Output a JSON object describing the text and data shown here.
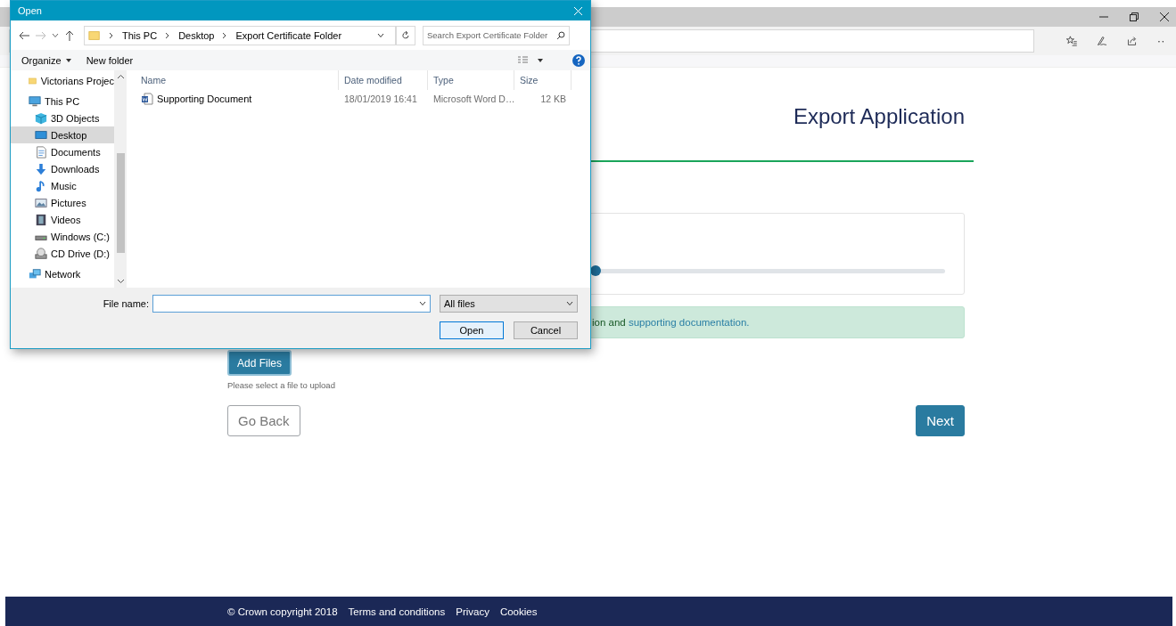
{
  "page": {
    "title": "Export Application",
    "upload": {
      "level": 0.5
    },
    "alert": {
      "text": "ion and ",
      "link": "supporting documentation."
    },
    "add_files": "Add Files",
    "help": "Please select a file to upload",
    "buttons": [
      {
        "label": "Go Back",
        "kind": "secondary"
      },
      {
        "label": "Next",
        "kind": "primary"
      }
    ]
  },
  "footer": {
    "copyright": "© Crown copyright 2018",
    "links": [
      "Terms and conditions",
      "Privacy",
      "Cookies"
    ]
  },
  "dialog": {
    "title": "Open",
    "breadcrumb": [
      "This PC",
      "Desktop",
      "Export Certificate Folder"
    ],
    "search": {
      "placeholder": "Search Export Certificate Folder"
    },
    "toolbar": {
      "organize": "Organize",
      "new_folder": "New folder"
    },
    "nav": [
      {
        "label": "Victorians Projec",
        "kind": "folder",
        "selected": false
      },
      {
        "label": "This PC",
        "kind": "pc",
        "selected": false,
        "children": [
          {
            "label": "3D Objects",
            "kind": "cube",
            "selected": false
          },
          {
            "label": "Desktop",
            "kind": "desktop",
            "selected": true
          },
          {
            "label": "Documents",
            "kind": "docs",
            "selected": false
          },
          {
            "label": "Downloads",
            "kind": "download",
            "selected": false
          },
          {
            "label": "Music",
            "kind": "music",
            "selected": false
          },
          {
            "label": "Pictures",
            "kind": "pictures",
            "selected": false
          },
          {
            "label": "Videos",
            "kind": "videos",
            "selected": false
          },
          {
            "label": "Windows (C:)",
            "kind": "drive",
            "selected": false
          },
          {
            "label": "CD Drive (D:)",
            "kind": "cd",
            "selected": false
          }
        ]
      },
      {
        "label": "Network",
        "kind": "network",
        "selected": false
      }
    ],
    "columns": [
      "Name",
      "Date modified",
      "Type",
      "Size"
    ],
    "files": [
      {
        "name": "Supporting Document",
        "date": "18/01/2019 16:41",
        "type": "Microsoft Word D…",
        "size": "12 KB",
        "selected": false
      }
    ],
    "file_name": {
      "label": "File name:"
    },
    "file_type": "All files",
    "buttons": [
      "Open",
      "Cancel"
    ]
  }
}
